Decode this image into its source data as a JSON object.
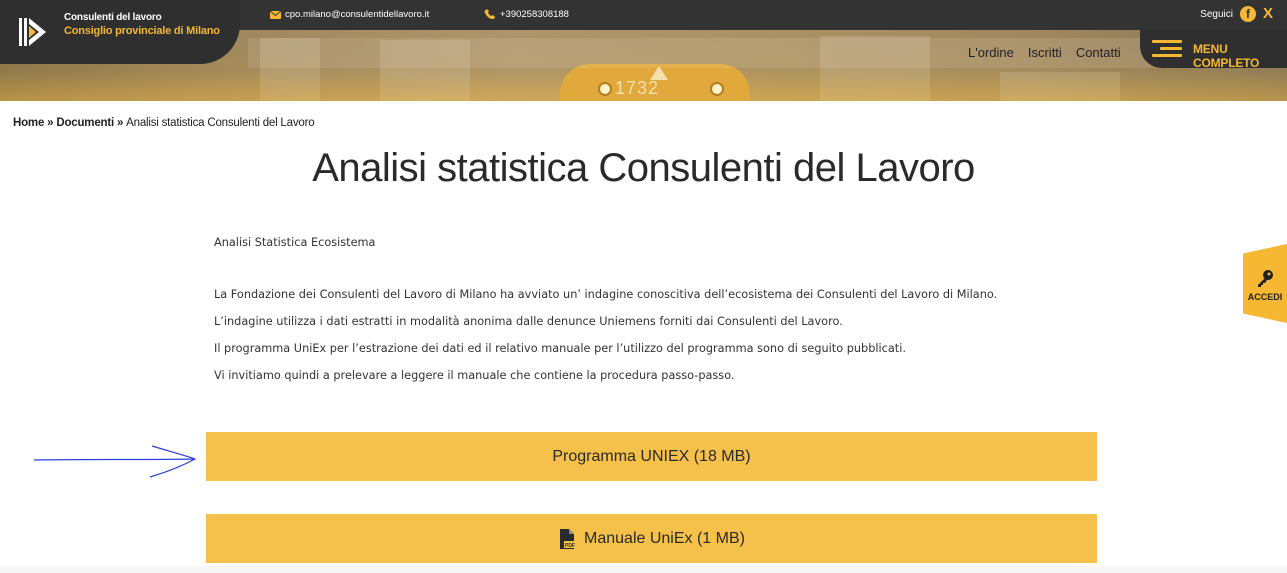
{
  "header": {
    "org_line1": "Consulenti del lavoro",
    "org_line2": "Consiglio provinciale di Milano",
    "email": "cpo.milano@consulentidellavoro.it",
    "phone": "+390258308188",
    "follow_label": "Seguici",
    "social": [
      "facebook-icon",
      "x-icon"
    ],
    "nav": [
      "L'ordine",
      "Iscritti",
      "Contatti"
    ],
    "menu_label": "MENU COMPLETO",
    "banner_number": "1732"
  },
  "breadcrumb": {
    "home": "Home",
    "sep1": " » ",
    "documents": "Documenti",
    "sep2": " » ",
    "current": "Analisi statistica Consulenti del Lavoro"
  },
  "page": {
    "title": "Analisi statistica Consulenti del Lavoro",
    "subtitle": "Analisi Statistica Ecosistema",
    "paragraphs": [
      "La Fondazione dei Consulenti del Lavoro di Milano ha avviato un’ indagine conoscitiva dell’ecosistema dei Consulenti del Lavoro di Milano.",
      "L’indagine utilizza i dati estratti in modalità anonima dalle denunce Uniemens forniti dai Consulenti del Lavoro.",
      "Il programma UniEx per l’estrazione dei dati ed il relativo manuale per l’utilizzo del programma sono di seguito pubblicati.",
      "Vi invitiamo quindi a prelevare a leggere il manuale che contiene la procedura passo-passo."
    ]
  },
  "downloads": {
    "program": "Programma UNIEX (18 MB)",
    "manual": "Manuale UniEx (1 MB)"
  },
  "side": {
    "login_label": "ACCEDI"
  },
  "colors": {
    "accent": "#f6b733",
    "button": "#f6c14a",
    "dark": "#2f2f2f",
    "annotation_arrow": "#2b3fd8"
  }
}
